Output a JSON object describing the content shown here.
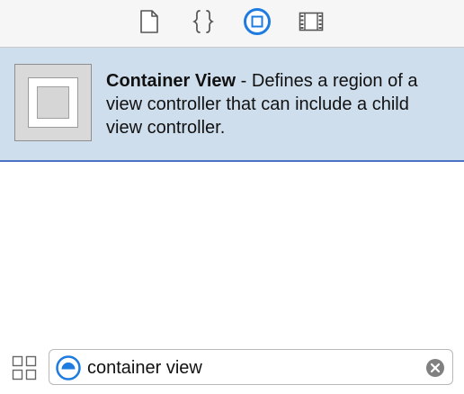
{
  "tabbar": {
    "tabs": [
      {
        "icon": "file-template-icon",
        "selected": false
      },
      {
        "icon": "code-snippet-icon",
        "selected": false
      },
      {
        "icon": "object-library-icon",
        "selected": true
      },
      {
        "icon": "media-library-icon",
        "selected": false
      }
    ],
    "accent": "#1e7be0"
  },
  "library": {
    "items": [
      {
        "title": "Container View",
        "separator": " - ",
        "description": "Defines a region of a view controller that can include a child view controller.",
        "selected": true,
        "icon": "container-view-icon"
      }
    ],
    "selection_background": "#cfdeed",
    "selection_border": "#4a73c6"
  },
  "filter": {
    "view_toggle_icon": "grid-view-icon",
    "scope_icon": "scope-filter-icon",
    "value": "container view",
    "clear_icon": "clear-search-icon"
  }
}
